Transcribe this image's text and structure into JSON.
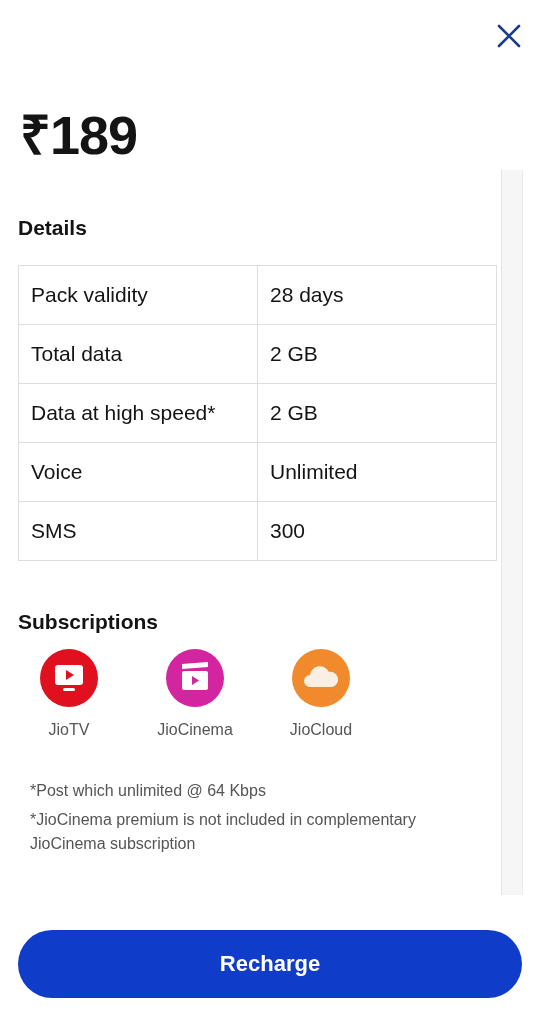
{
  "price": "₹189",
  "details": {
    "title": "Details",
    "rows": [
      {
        "label": "Pack validity",
        "value": "28 days"
      },
      {
        "label": "Total data",
        "value": "2 GB"
      },
      {
        "label": "Data at high speed*",
        "value": "2 GB"
      },
      {
        "label": "Voice",
        "value": "Unlimited"
      },
      {
        "label": "SMS",
        "value": "300"
      }
    ]
  },
  "subscriptions": {
    "title": "Subscriptions",
    "items": [
      {
        "kind": "tv",
        "name": "JioTV",
        "color": "#e0101e"
      },
      {
        "kind": "cinema",
        "name": "JioCinema",
        "color": "#d3259f"
      },
      {
        "kind": "cloud",
        "name": "JioCloud",
        "color": "#f08a2c"
      }
    ]
  },
  "footnotes": [
    "*Post which unlimited @ 64 Kbps",
    "*JioCinema premium is not included in complementary JioCinema subscription"
  ],
  "button": "Recharge"
}
